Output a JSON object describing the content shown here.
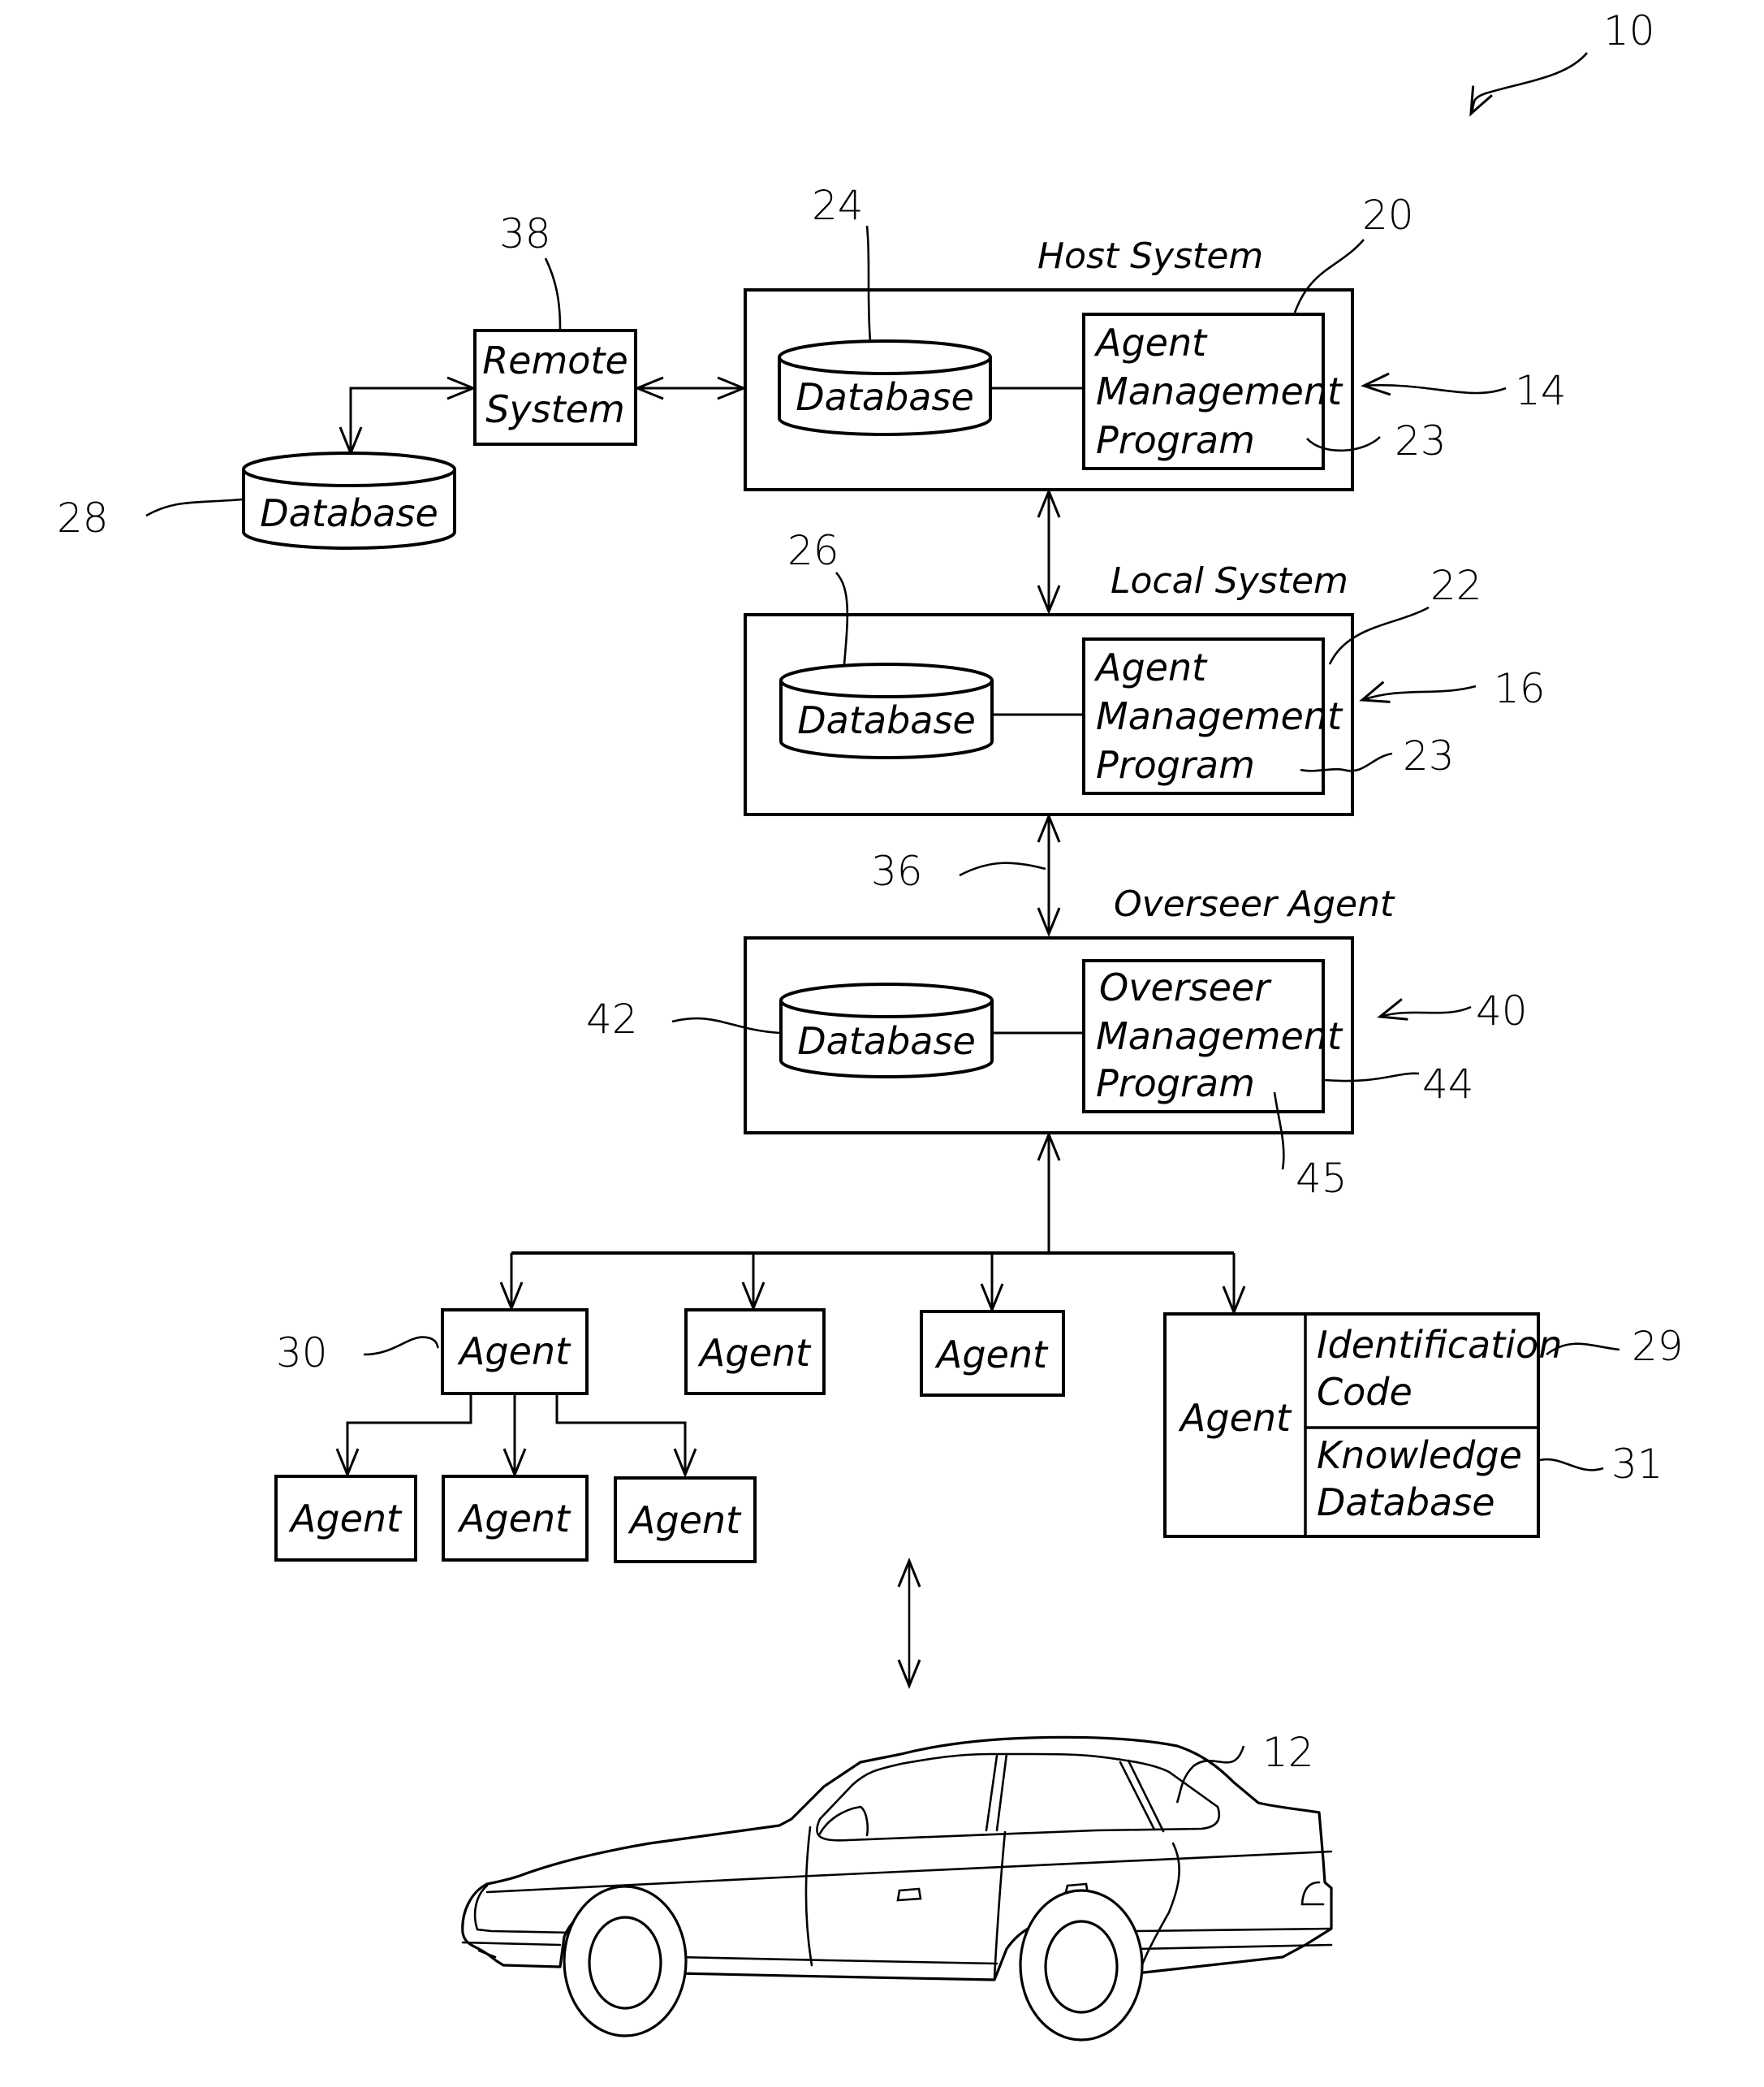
{
  "figure_ref": "10",
  "host_system": {
    "title": "Host System",
    "ref": "14",
    "program_ref": "20",
    "program_lines": [
      "Agent",
      "Management",
      "Program"
    ],
    "program_sub_ref": "23",
    "database_label": "Database",
    "database_ref": "24"
  },
  "remote_system": {
    "lines": [
      "Remote",
      "System"
    ],
    "ref": "38",
    "database_label": "Database",
    "database_ref": "28"
  },
  "local_system": {
    "title": "Local System",
    "ref": "16",
    "program_ref": "22",
    "program_lines": [
      "Agent",
      "Management",
      "Program"
    ],
    "program_sub_ref": "23",
    "database_label": "Database",
    "database_ref": "26",
    "link_ref": "36"
  },
  "overseer_agent": {
    "title": "Overseer Agent",
    "ref": "40",
    "program_ref": "44",
    "program_lines": [
      "Overseer",
      "Management",
      "Program"
    ],
    "program_sub_ref": "45",
    "database_label": "Database",
    "database_ref": "42"
  },
  "agents": {
    "primary_ref": "30",
    "row1": [
      "Agent",
      "Agent",
      "Agent"
    ],
    "row2": [
      "Agent",
      "Agent",
      "Agent"
    ],
    "detail": {
      "label": "Agent",
      "id_lines": [
        "Identification",
        "Code"
      ],
      "id_ref": "29",
      "kb_lines": [
        "Knowledge",
        "Database"
      ],
      "kb_ref": "31"
    }
  },
  "vehicle": {
    "ref": "12"
  }
}
